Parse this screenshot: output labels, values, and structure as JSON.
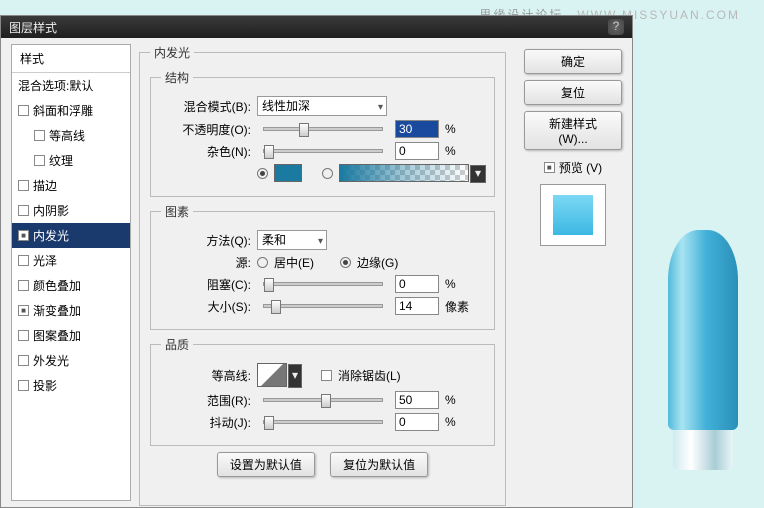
{
  "watermark": {
    "cn": "思缘设计论坛",
    "en": "WWW.MISSYUAN.COM"
  },
  "title": "图层样式",
  "sidebar": {
    "head": "样式",
    "blend": "混合选项:默认",
    "items": [
      {
        "label": "斜面和浮雕",
        "checked": false
      },
      {
        "label": "等高线",
        "checked": false,
        "indent": true
      },
      {
        "label": "纹理",
        "checked": false,
        "indent": true
      },
      {
        "label": "描边",
        "checked": false
      },
      {
        "label": "内阴影",
        "checked": false
      },
      {
        "label": "内发光",
        "checked": true,
        "selected": true
      },
      {
        "label": "光泽",
        "checked": false
      },
      {
        "label": "颜色叠加",
        "checked": false
      },
      {
        "label": "渐变叠加",
        "checked": true
      },
      {
        "label": "图案叠加",
        "checked": false
      },
      {
        "label": "外发光",
        "checked": false
      },
      {
        "label": "投影",
        "checked": false
      }
    ]
  },
  "panel": {
    "title": "内发光",
    "structure": {
      "legend": "结构",
      "blendLabel": "混合模式(B):",
      "blendValue": "线性加深",
      "opacityLabel": "不透明度(O):",
      "opacityValue": "30",
      "pct": "%",
      "noiseLabel": "杂色(N):",
      "noiseValue": "0"
    },
    "element": {
      "legend": "图素",
      "methodLabel": "方法(Q):",
      "methodValue": "柔和",
      "sourceLabel": "源:",
      "centerLabel": "居中(E)",
      "edgeLabel": "边缘(G)",
      "chokeLabel": "阻塞(C):",
      "chokeValue": "0",
      "sizeLabel": "大小(S):",
      "sizeValue": "14",
      "px": "像素"
    },
    "quality": {
      "legend": "品质",
      "contourLabel": "等高线:",
      "antiLabel": "消除锯齿(L)",
      "rangeLabel": "范围(R):",
      "rangeValue": "50",
      "jitterLabel": "抖动(J):",
      "jitterValue": "0"
    },
    "defaults": {
      "set": "设置为默认值",
      "reset": "复位为默认值"
    }
  },
  "right": {
    "ok": "确定",
    "cancel": "复位",
    "newStyle": "新建样式(W)...",
    "preview": "预览 (V)"
  }
}
